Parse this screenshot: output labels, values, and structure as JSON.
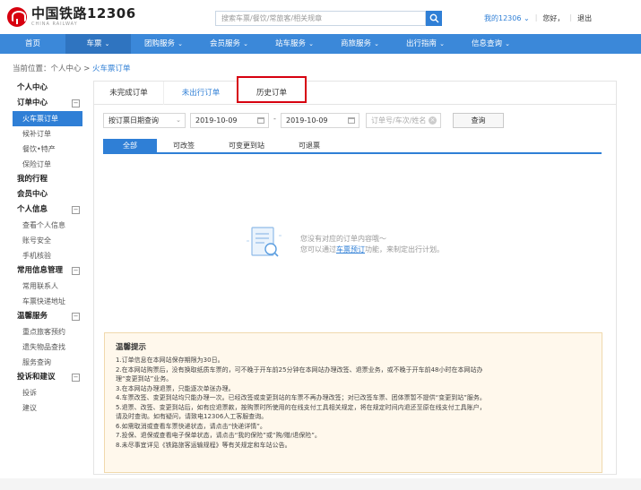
{
  "header": {
    "logo_title": "中国铁路12306",
    "logo_sub": "CHINA RAILWAY",
    "search_placeholder": "搜索车票/餐饮/常旅客/相关规章",
    "links": {
      "my12306": "我的12306 ⌄",
      "greeting": "您好，",
      "logout": "退出"
    }
  },
  "nav": [
    {
      "label": "首页",
      "caret": ""
    },
    {
      "label": "车票",
      "caret": "⌄"
    },
    {
      "label": "团购服务",
      "caret": "⌄"
    },
    {
      "label": "会员服务",
      "caret": "⌄"
    },
    {
      "label": "站车服务",
      "caret": "⌄"
    },
    {
      "label": "商旅服务",
      "caret": "⌄"
    },
    {
      "label": "出行指南",
      "caret": "⌄"
    },
    {
      "label": "信息查询",
      "caret": "⌄"
    }
  ],
  "breadcrumb": {
    "prefix": "当前位置：个人中心 > ",
    "current": "火车票订单"
  },
  "sidebar": {
    "personal_center": "个人中心",
    "order_center": "订单中心",
    "order_items": [
      "火车票订单",
      "候补订单",
      "餐饮•特产",
      "保险订单"
    ],
    "my_trip": "我的行程",
    "member_center": "会员中心",
    "personal_info": "个人信息",
    "personal_info_items": [
      "查看个人信息",
      "账号安全",
      "手机核验"
    ],
    "common_info": "常用信息管理",
    "common_info_items": [
      "常用联系人",
      "车票快递地址"
    ],
    "warm_service": "温馨服务",
    "warm_service_items": [
      "重点旅客预约",
      "遗失物品查找",
      "服务查询"
    ],
    "complaint": "投诉和建议",
    "complaint_items": [
      "投诉",
      "建议"
    ],
    "toggle": "−"
  },
  "tabs": {
    "incomplete": "未完成订单",
    "not_traveled": "未出行订单",
    "history": "历史订单"
  },
  "filters": {
    "date_type": "按订票日期查询",
    "date_from": "2019-10-09",
    "date_to": "2019-10-09",
    "dash": "-",
    "order_placeholder": "订单号/车次/姓名",
    "query_button": "查询"
  },
  "subtabs": [
    "全部",
    "可改签",
    "可变更到站",
    "可退票"
  ],
  "empty": {
    "line1": "您没有对应的订单内容哦～",
    "line2_prefix": "您可以通过",
    "line2_link": "车票预订",
    "line2_suffix": "功能，来制定出行计划。"
  },
  "notice": {
    "title": "温馨提示",
    "lines": [
      "1.订单信息在本网站保存期限为30日。",
      "2.在本网站购票后，没有换取纸质车票的，可不晚于开车前25分钟在本网站办理改签、退票业务，或不晚于开车前48小时在本网站办",
      "理“变更到站”业务。",
      "3.在本网站办理退票，只能逐次单张办理。",
      "4.车票改签、变更到站均只能办理一次。已经改签或变更到站的车票不再办理改签；对已改签车票、团体票暂不提供“变更到站”服务。",
      "5.退票、改签、变更到站后，如有应退票款，按购票时所使用的在线支付工具相关规定，将在规定时间内退还至原在线支付工具账户，",
      "请及时查询。如有疑问，请致电12306人工客服查询。",
      "6.如需取消或查看车票快递状态，请点击“快递详情”。",
      "7.投保、退保或查看电子保单状态，请点击“我的保险”或“购/赠/退保险”。",
      "8.未尽事宜详见《铁路旅客运输规程》等有关规定和车站公告。"
    ]
  }
}
